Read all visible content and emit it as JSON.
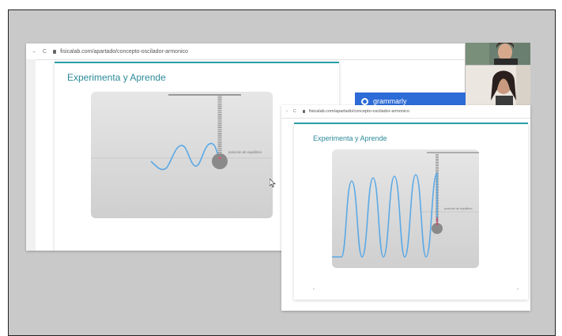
{
  "back_window": {
    "url": "fisicalab.com/apartado/concepto-oscilador-armonico",
    "panel_title": "Experimenta y Aprende",
    "equilibrium_label": "posición de equilibrio"
  },
  "front_window": {
    "url": "fisicalab.com/apartado/concepto-oscilador-armonico",
    "panel_title": "Experimenta y Aprende",
    "equilibrium_label": "posición de equilibrio"
  },
  "grammarly": {
    "label": "grammarly"
  },
  "colors": {
    "accent": "#2aa0a8",
    "title": "#2b8a99",
    "wave": "#5aa9e6",
    "spring": "#9a9a9a",
    "mass": "#8a8a8a",
    "grammarly": "#2d6bd6"
  },
  "icons": {
    "back": "arrow-left-icon",
    "reload": "reload-icon",
    "lock": "lock-icon",
    "cursor": "mouse-pointer-icon"
  }
}
